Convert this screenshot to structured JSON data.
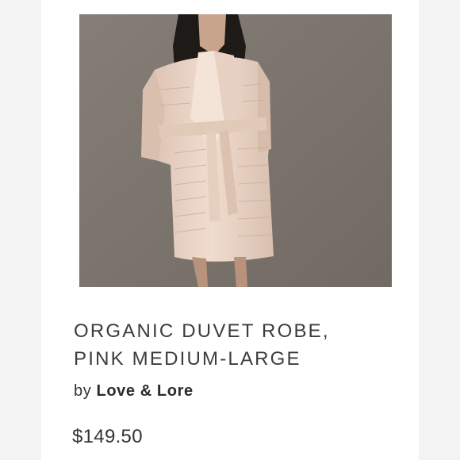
{
  "product": {
    "title_line1": "ORGANIC DUVET ROBE,",
    "title_line2": "PINK MEDIUM-LARGE",
    "by_prefix": "by",
    "brand": "Love & Lore",
    "price": "$149.50"
  },
  "colors": {
    "photo_background": "#7d766f",
    "robe": "#e9d2c3",
    "text": "#3c3c3c"
  }
}
